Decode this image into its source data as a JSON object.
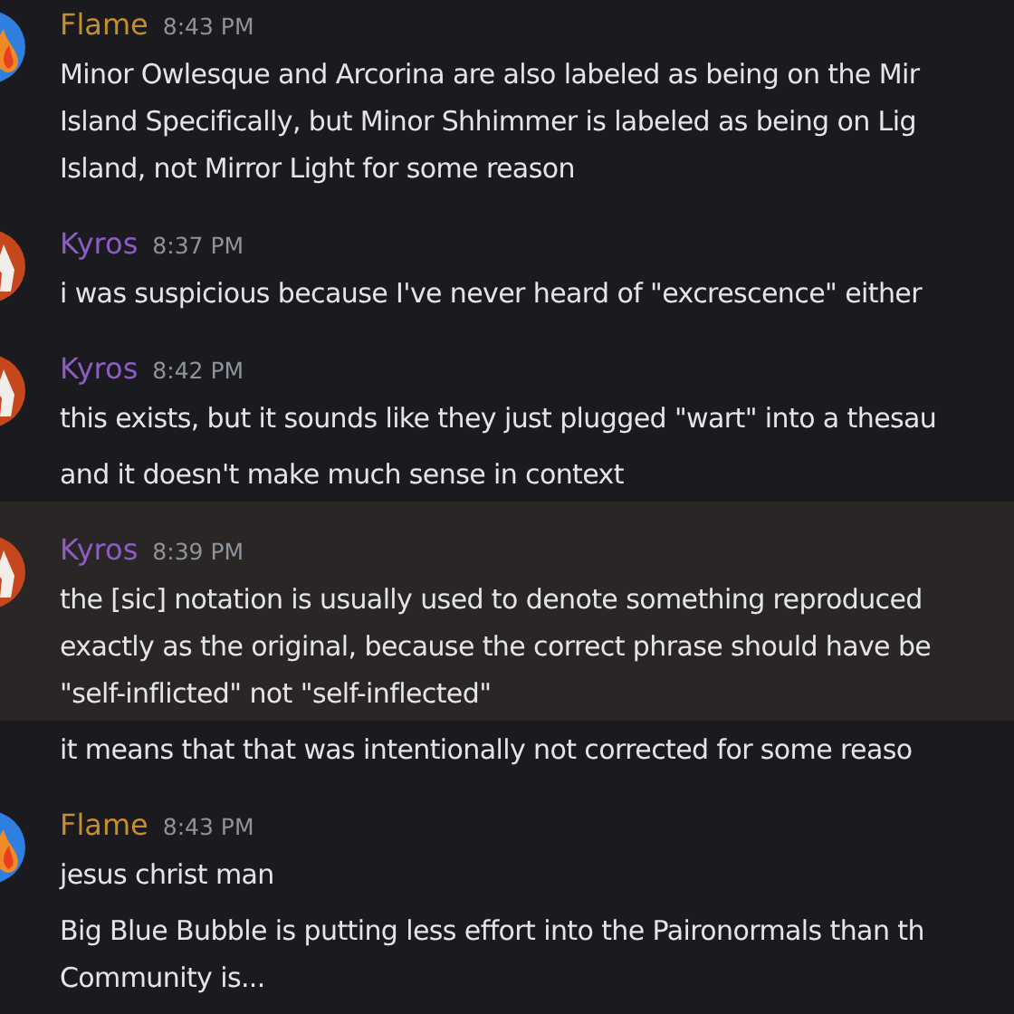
{
  "groups": [
    {
      "author": "Flame",
      "color": "#c58f2c",
      "time": "8:43 PM",
      "kind": "flame",
      "messages": [
        {
          "highlighted": false,
          "lines": [
            "Minor Owlesque and Arcorina are also labeled as being on the Mir",
            "Island Specifically, but Minor Shhimmer is labeled as being on Lig",
            "Island, not Mirror Light for some reason"
          ]
        }
      ]
    },
    {
      "author": "Kyros",
      "color": "#8d5cc4",
      "time": "8:37 PM",
      "kind": "figure",
      "messages": [
        {
          "highlighted": false,
          "lines": [
            "i was suspicious because I've never heard of \"excrescence\" either"
          ]
        }
      ]
    },
    {
      "author": "Kyros",
      "color": "#8d5cc4",
      "time": "8:42 PM",
      "kind": "figure",
      "messages": [
        {
          "highlighted": false,
          "lines": [
            "this exists, but it sounds like they just plugged \"wart\" into a thesau"
          ]
        },
        {
          "highlighted": false,
          "lines": [
            "and it doesn't make much sense in context"
          ]
        }
      ]
    },
    {
      "author": "Kyros",
      "color": "#8d5cc4",
      "time": "8:39 PM",
      "kind": "figure",
      "messages": [
        {
          "highlighted": true,
          "lines": [
            "the [sic] notation is usually used to denote something reproduced",
            "exactly as the original, because the correct phrase should have be",
            "\"self-inflicted\" not \"self-inflected\""
          ]
        },
        {
          "highlighted": false,
          "lines": [
            "it means that that was intentionally not corrected for some reaso"
          ]
        }
      ]
    },
    {
      "author": "Flame",
      "color": "#c58f2c",
      "time": "8:43 PM",
      "kind": "flame",
      "messages": [
        {
          "highlighted": false,
          "lines": [
            "jesus christ man"
          ]
        },
        {
          "highlighted": false,
          "lines": [
            "Big Blue Bubble is putting less effort into the Paironormals than th",
            "Community is..."
          ]
        }
      ]
    }
  ]
}
